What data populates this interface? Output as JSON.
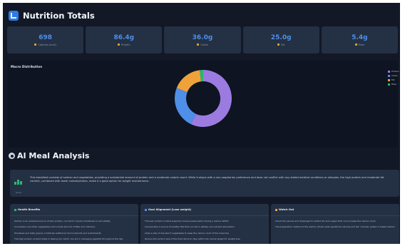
{
  "header": {
    "title": "Nutrition Totals",
    "icon": "chart-icon"
  },
  "totals": [
    {
      "value": "698",
      "label": "Calories (kcal)",
      "color": "#4f8fe8"
    },
    {
      "value": "86.4g",
      "label": "Protein",
      "color": "#4f8fe8"
    },
    {
      "value": "36.0g",
      "label": "Carbs",
      "color": "#4f8fe8"
    },
    {
      "value": "25.0g",
      "label": "Fat",
      "color": "#4f8fe8"
    },
    {
      "value": "5.4g",
      "label": "Fiber",
      "color": "#4f8fe8"
    }
  ],
  "distribution": {
    "title": "Macro Distribution",
    "chart_data": {
      "type": "pie",
      "categories": [
        "Protein",
        "Carbs",
        "Fat",
        "Fiber"
      ],
      "values": [
        57,
        24,
        17,
        2
      ],
      "colors": [
        "#9b7be0",
        "#4f8fe8",
        "#f0a23a",
        "#2bb673"
      ]
    }
  },
  "ai": {
    "title": "AI Meal Analysis",
    "summary_label": "Score",
    "summary": "This breakfast consists of salmon and vegetables, providing a substantial amount of protein and a moderate calorie count. While it aligns with a non-vegetarian preference and does not conflict with any stated medical conditions or allergies, the high protein and moderate fat content, combined with lower carbohydrates, make it a good option for weight maintenance."
  },
  "columns": [
    {
      "title": "Health Benefits",
      "color": "#2bb673",
      "items": [
        "Salmon is an excellent source of lean protein, crucial for muscle maintenance and satiety.",
        "Cucumbers and other vegetables add a small amount of fiber and vitamins.",
        "Tomatoes and leafy greens contribute additional micronutrients and antioxidants.",
        "The high protein content helps in feeling full, which can aid in managing appetite throughout the day."
      ]
    },
    {
      "title": "Goal Alignment (Lose weight)",
      "color": "#4f8fe8",
      "items": [
        "The lean protein content supports muscle preservation during a calorie deficit.",
        "Incorporates a source of healthy fats that can aid in satiety and nutrient absorption.",
        "Adds a side of low-starch vegetables to keep the calorie count of the meal low.",
        "Reduce the portion size of the fried items to stay within the calorie target for weight loss."
      ]
    },
    {
      "title": "Watch Out",
      "color": "#f0a23a",
      "items": [
        "Check the sauces and dressings for added oils and sugars that can increase the calorie count.",
        "The preparation method of the salmon (fried) adds significant calories and fat; consider grilled or baked salmon instead for lower calories."
      ]
    }
  ]
}
